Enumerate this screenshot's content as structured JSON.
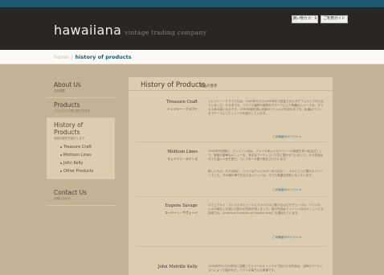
{
  "header": {
    "logo": "hawaiiana",
    "tagline": "vintage trading company",
    "buttons": [
      "買い物カゴ：0",
      "ご利用ガイド"
    ]
  },
  "breadcrumb": {
    "home": "home",
    "separator": "/",
    "current": "history of products"
  },
  "sidebar": {
    "items": [
      {
        "title": "About Us",
        "subtitle": "会社概要"
      },
      {
        "title": "Products",
        "subtitle": "こちらからお買い物できます"
      },
      {
        "title": "History of Products",
        "subtitle": "商品の歴史を紹介します",
        "subitems": [
          "Treasure Craft",
          "Mottson Lines",
          "John Kelly",
          "Other Products"
        ]
      },
      {
        "title": "Contact Us",
        "subtitle": "お問い合わせ"
      }
    ]
  },
  "main": {
    "title": "History of Products",
    "subtitle": "商品の歴史",
    "entries": [
      {
        "name": "Treasure Craft",
        "jp": "トレジャー・クラフト",
        "text": "トレジャー・クラフト社は、1940年代から1950年まで設定されたタグフェルトで作られていました。その中でも、ハワイの植物や動物をモチーフにした陶器のシリーズは、今でも人気の高いものです。1950年頃を境に木製のジャンルの作品の中でも、私達はハワイをモチーフにしたシリーズを紹介しています。",
        "link": "この商品のページへ >"
      },
      {
        "name": "Mottson Lines",
        "jp": "マットソン・ラインズ",
        "text": "1930年代初頭に、マットソン社は、アメリカ本土からハワイへの航路を持つ船会社として、客船の豪華なメニューを、有名なアーティストたちに描かせていました。その作品は今でも高い人気を誇り、コレクターの間で取引されています。",
        "text2": "新しいもの、その当時に、ハワイはアメリカの一州ではなく、人々にとって憧れのリゾートでした。その頃の様子を伝えるメニューは、今でも貴重な資料となっています。",
        "link": "この商品のページへ >"
      },
      {
        "name": "Eugene Savage",
        "jp": "ユージーン・サヴェージ",
        "text": "エデュアルド・コンベスタミュールとラスベガスに移り住んだサヴェージは、ハワイの人々の暮らしを描いた数々の作品を残しました。彼の作品はマットソン社のメニューにも採用され、American Institute of Graphic Artsにも選ばれています。",
        "link": "この商品のページへ >"
      },
      {
        "name": "John Melville Kelly",
        "jp": "",
        "text": "1930年代から50年代に活躍したケリーのオリジナルで知られる作品は、当時のアーティストによって描かれた、ハワイの暮らしの風景です。",
        "link": ""
      }
    ]
  }
}
